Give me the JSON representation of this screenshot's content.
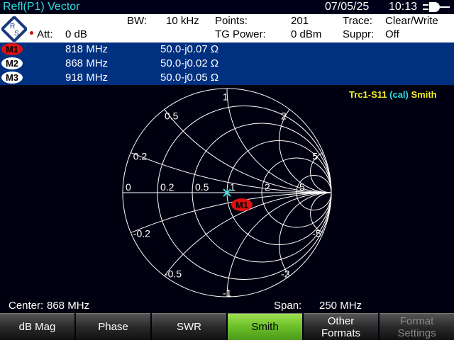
{
  "header": {
    "title": "Refl(P1) Vector",
    "date": "07/05/25",
    "time": "10:13"
  },
  "info": {
    "bw_label": "BW:",
    "bw": "10 kHz",
    "points_label": "Points:",
    "points": "201",
    "trace_label": "Trace:",
    "trace": "Clear/Write",
    "att_label": "Att:",
    "att": "0 dB",
    "tg_label": "TG Power:",
    "tg": "0 dBm",
    "suppr_label": "Suppr:",
    "suppr": "Off",
    "logo": "R&S"
  },
  "markers": [
    {
      "name": "M1",
      "freq": "818 MHz",
      "value": "50.0-j0.07 Ω",
      "color": "#e01010"
    },
    {
      "name": "M2",
      "freq": "868 MHz",
      "value": "50.0-j0.02 Ω",
      "color": "#ffffff"
    },
    {
      "name": "M3",
      "freq": "918 MHz",
      "value": "50.0-j0.05 Ω",
      "color": "#ffffff"
    }
  ],
  "chart_data": {
    "type": "smith",
    "trace_label": "Trc1",
    "trace_param": "S11",
    "trace_cal": "(cal)",
    "trace_format": "Smith",
    "resistance_circles": [
      0.2,
      0.5,
      1,
      2,
      5
    ],
    "reactance_arcs": [
      0.2,
      0.5,
      1,
      2,
      5
    ],
    "resistance_labels": [
      "0",
      "0.2",
      "0.5",
      "1",
      "2",
      "5"
    ],
    "reactance_labels": [
      "0.2",
      "0.5",
      "1",
      "2",
      "5",
      "-0.2",
      "-0.5",
      "-1",
      "-2",
      "-5"
    ],
    "marker": {
      "name": "M1",
      "r": 1.0,
      "x": -0.0014
    }
  },
  "bottom": {
    "center_label": "Center:",
    "center": "868 MHz",
    "span_label": "Span:",
    "span": "250 MHz"
  },
  "softkeys": [
    "dB Mag",
    "Phase",
    "SWR",
    "Smith",
    "Other\nFormats",
    "Format\nSettings"
  ]
}
